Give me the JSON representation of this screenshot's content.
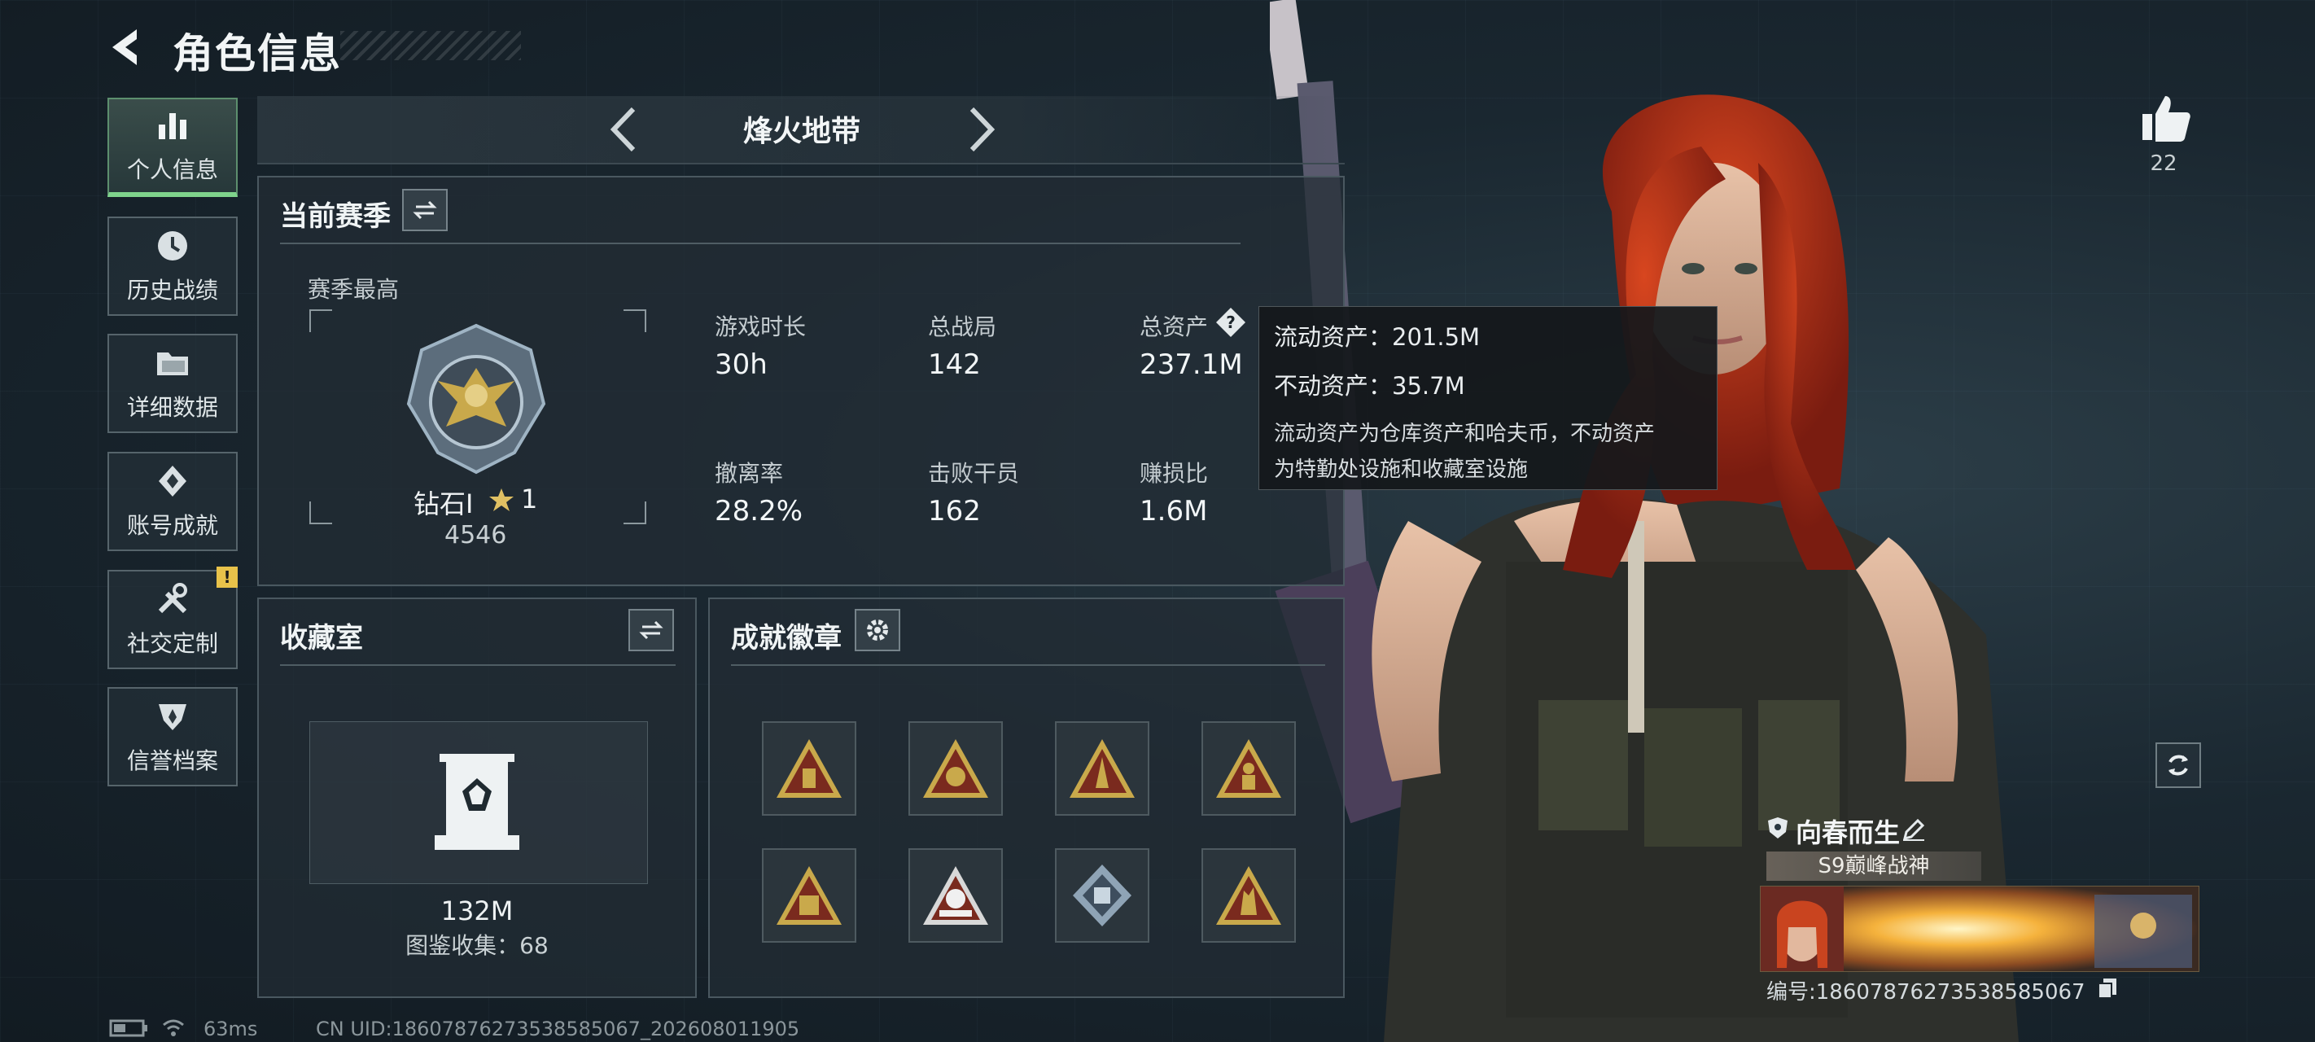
{
  "header": {
    "title": "角色信息"
  },
  "sidebar": {
    "items": [
      {
        "label": "个人信息",
        "icon": "bar-chart-icon",
        "active": true
      },
      {
        "label": "历史战绩",
        "icon": "clock-icon"
      },
      {
        "label": "详细数据",
        "icon": "folder-icon"
      },
      {
        "label": "账号成就",
        "icon": "achievement-icon"
      },
      {
        "label": "社交定制",
        "icon": "tools-icon",
        "notice": "!"
      },
      {
        "label": "信誉档案",
        "icon": "reputation-icon"
      }
    ]
  },
  "mode": {
    "title": "烽火地带"
  },
  "season": {
    "title": "当前赛季",
    "best_label": "赛季最高",
    "rank_name": "钻石Ⅰ",
    "rank_stars": "1",
    "rank_score": "4546",
    "stats": [
      {
        "label": "游戏时长",
        "value": "30h"
      },
      {
        "label": "总战局",
        "value": "142"
      },
      {
        "label": "总资产",
        "value": "237.1M"
      },
      {
        "label": "撤离率",
        "value": "28.2%"
      },
      {
        "label": "击败干员",
        "value": "162"
      },
      {
        "label": "赚损比",
        "value": "1.6M"
      }
    ]
  },
  "tooltip": {
    "liquid": "流动资产：201.5M",
    "fixed": "不动资产：35.7M",
    "desc_line1": "流动资产为仓库资产和哈夫币，不动资产",
    "desc_line2": "为特勤处设施和收藏室设施"
  },
  "collection": {
    "title": "收藏室",
    "value": "132M",
    "catalog": "图鉴收集：68"
  },
  "badges": {
    "title": "成就徽章",
    "items": [
      "badge-1",
      "badge-2",
      "badge-3",
      "badge-4",
      "badge-5",
      "badge-6",
      "badge-7",
      "badge-8"
    ]
  },
  "likes": {
    "count": "22"
  },
  "player": {
    "name": "向春而生",
    "title": "S9巅峰战神",
    "id": "编号:1860787627353858506​7"
  },
  "footer": {
    "ping": "63ms",
    "uid": "CN UID:18607876273538585067_202608011905"
  },
  "colors": {
    "accent_green": "#7fd38c",
    "gold": "#c9a94b",
    "badge_red": "#7a2a1e"
  }
}
